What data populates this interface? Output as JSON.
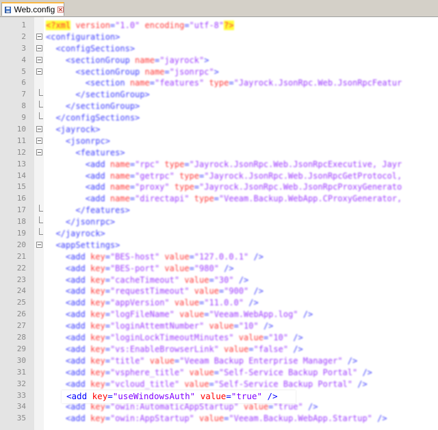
{
  "tab": {
    "label": "Web.config"
  },
  "colors": {
    "tag": "#0000ff",
    "attr": "#ff0000",
    "value": "#8000ff",
    "tab_accent": "#f9b642"
  },
  "lines": [
    {
      "n": "1",
      "fold": "none",
      "segs": [
        [
          "pi",
          "<?xml"
        ],
        [
          "attr",
          " version"
        ],
        [
          "tag",
          "="
        ],
        [
          "val",
          "\"1.0\""
        ],
        [
          "attr",
          " encoding"
        ],
        [
          "tag",
          "="
        ],
        [
          "val",
          "\"utf-8\""
        ],
        [
          "pi",
          "?>"
        ]
      ]
    },
    {
      "n": "2",
      "fold": "open",
      "segs": [
        [
          "tag",
          "<configuration>"
        ]
      ]
    },
    {
      "n": "3",
      "fold": "open",
      "segs": [
        [
          "tag",
          "  <configSections>"
        ]
      ]
    },
    {
      "n": "4",
      "fold": "open",
      "segs": [
        [
          "tag",
          "    <sectionGroup "
        ],
        [
          "attr",
          "name"
        ],
        [
          "tag",
          "="
        ],
        [
          "val",
          "\"jayrock\""
        ],
        [
          "tag",
          ">"
        ]
      ]
    },
    {
      "n": "5",
      "fold": "open",
      "segs": [
        [
          "tag",
          "      <sectionGroup "
        ],
        [
          "attr",
          "name"
        ],
        [
          "tag",
          "="
        ],
        [
          "val",
          "\"jsonrpc\""
        ],
        [
          "tag",
          ">"
        ]
      ]
    },
    {
      "n": "6",
      "fold": "line",
      "segs": [
        [
          "tag",
          "        <section "
        ],
        [
          "attr",
          "name"
        ],
        [
          "tag",
          "="
        ],
        [
          "val",
          "\"features\""
        ],
        [
          "attr",
          " type"
        ],
        [
          "tag",
          "="
        ],
        [
          "val",
          "\"Jayrock.JsonRpc.Web.JsonRpcFeatur"
        ]
      ]
    },
    {
      "n": "7",
      "fold": "end",
      "segs": [
        [
          "tag",
          "      </sectionGroup>"
        ]
      ]
    },
    {
      "n": "8",
      "fold": "end",
      "segs": [
        [
          "tag",
          "    </sectionGroup>"
        ]
      ]
    },
    {
      "n": "9",
      "fold": "end",
      "segs": [
        [
          "tag",
          "  </configSections>"
        ]
      ]
    },
    {
      "n": "10",
      "fold": "open",
      "segs": [
        [
          "tag",
          "  <jayrock>"
        ]
      ]
    },
    {
      "n": "11",
      "fold": "open",
      "segs": [
        [
          "tag",
          "    <jsonrpc>"
        ]
      ]
    },
    {
      "n": "12",
      "fold": "open",
      "segs": [
        [
          "tag",
          "      <features>"
        ]
      ]
    },
    {
      "n": "13",
      "fold": "line",
      "segs": [
        [
          "tag",
          "        <add "
        ],
        [
          "attr",
          "name"
        ],
        [
          "tag",
          "="
        ],
        [
          "val",
          "\"rpc\""
        ],
        [
          "attr",
          " type"
        ],
        [
          "tag",
          "="
        ],
        [
          "val",
          "\"Jayrock.JsonRpc.Web.JsonRpcExecutive, Jayr"
        ]
      ]
    },
    {
      "n": "14",
      "fold": "line",
      "segs": [
        [
          "tag",
          "        <add "
        ],
        [
          "attr",
          "name"
        ],
        [
          "tag",
          "="
        ],
        [
          "val",
          "\"getrpc\""
        ],
        [
          "attr",
          " type"
        ],
        [
          "tag",
          "="
        ],
        [
          "val",
          "\"Jayrock.JsonRpc.Web.JsonRpcGetProtocol,"
        ]
      ]
    },
    {
      "n": "15",
      "fold": "line",
      "segs": [
        [
          "tag",
          "        <add "
        ],
        [
          "attr",
          "name"
        ],
        [
          "tag",
          "="
        ],
        [
          "val",
          "\"proxy\""
        ],
        [
          "attr",
          " type"
        ],
        [
          "tag",
          "="
        ],
        [
          "val",
          "\"Jayrock.JsonRpc.Web.JsonRpcProxyGenerato"
        ]
      ]
    },
    {
      "n": "16",
      "fold": "line",
      "segs": [
        [
          "tag",
          "        <add "
        ],
        [
          "attr",
          "name"
        ],
        [
          "tag",
          "="
        ],
        [
          "val",
          "\"directapi\""
        ],
        [
          "attr",
          " type"
        ],
        [
          "tag",
          "="
        ],
        [
          "val",
          "\"Veeam.Backup.WebApp.CProxyGenerator,"
        ]
      ]
    },
    {
      "n": "17",
      "fold": "end",
      "segs": [
        [
          "tag",
          "      </features>"
        ]
      ]
    },
    {
      "n": "18",
      "fold": "end",
      "segs": [
        [
          "tag",
          "    </jsonrpc>"
        ]
      ]
    },
    {
      "n": "19",
      "fold": "end",
      "segs": [
        [
          "tag",
          "  </jayrock>"
        ]
      ]
    },
    {
      "n": "20",
      "fold": "open",
      "segs": [
        [
          "tag",
          "  <appSettings>"
        ]
      ]
    },
    {
      "n": "21",
      "fold": "line",
      "segs": [
        [
          "tag",
          "    <add "
        ],
        [
          "attr",
          "key"
        ],
        [
          "tag",
          "="
        ],
        [
          "val",
          "\"BES-host\""
        ],
        [
          "attr",
          " value"
        ],
        [
          "tag",
          "="
        ],
        [
          "val",
          "\"127.0.0.1\""
        ],
        [
          "tag",
          " />"
        ]
      ]
    },
    {
      "n": "22",
      "fold": "line",
      "segs": [
        [
          "tag",
          "    <add "
        ],
        [
          "attr",
          "key"
        ],
        [
          "tag",
          "="
        ],
        [
          "val",
          "\"BES-port\""
        ],
        [
          "attr",
          " value"
        ],
        [
          "tag",
          "="
        ],
        [
          "val",
          "\"980\""
        ],
        [
          "tag",
          " />"
        ]
      ]
    },
    {
      "n": "23",
      "fold": "line",
      "segs": [
        [
          "tag",
          "    <add "
        ],
        [
          "attr",
          "key"
        ],
        [
          "tag",
          "="
        ],
        [
          "val",
          "\"cacheTimeout\""
        ],
        [
          "attr",
          " value"
        ],
        [
          "tag",
          "="
        ],
        [
          "val",
          "\"30\""
        ],
        [
          "tag",
          " />"
        ]
      ]
    },
    {
      "n": "24",
      "fold": "line",
      "segs": [
        [
          "tag",
          "    <add "
        ],
        [
          "attr",
          "key"
        ],
        [
          "tag",
          "="
        ],
        [
          "val",
          "\"requestTimeout\""
        ],
        [
          "attr",
          " value"
        ],
        [
          "tag",
          "="
        ],
        [
          "val",
          "\"900\""
        ],
        [
          "tag",
          " />"
        ]
      ]
    },
    {
      "n": "25",
      "fold": "line",
      "segs": [
        [
          "tag",
          "    <add "
        ],
        [
          "attr",
          "key"
        ],
        [
          "tag",
          "="
        ],
        [
          "val",
          "\"appVersion\""
        ],
        [
          "attr",
          " value"
        ],
        [
          "tag",
          "="
        ],
        [
          "val",
          "\"11.0.0\""
        ],
        [
          "tag",
          " />"
        ]
      ]
    },
    {
      "n": "26",
      "fold": "line",
      "segs": [
        [
          "tag",
          "    <add "
        ],
        [
          "attr",
          "key"
        ],
        [
          "tag",
          "="
        ],
        [
          "val",
          "\"logFileName\""
        ],
        [
          "attr",
          " value"
        ],
        [
          "tag",
          "="
        ],
        [
          "val",
          "\"Veeam.WebApp.log\""
        ],
        [
          "tag",
          " />"
        ]
      ]
    },
    {
      "n": "27",
      "fold": "line",
      "segs": [
        [
          "tag",
          "    <add "
        ],
        [
          "attr",
          "key"
        ],
        [
          "tag",
          "="
        ],
        [
          "val",
          "\"loginAttemtNumber\""
        ],
        [
          "attr",
          " value"
        ],
        [
          "tag",
          "="
        ],
        [
          "val",
          "\"10\""
        ],
        [
          "tag",
          " />"
        ]
      ]
    },
    {
      "n": "28",
      "fold": "line",
      "segs": [
        [
          "tag",
          "    <add "
        ],
        [
          "attr",
          "key"
        ],
        [
          "tag",
          "="
        ],
        [
          "val",
          "\"loginLockTimeoutMinutes\""
        ],
        [
          "attr",
          " value"
        ],
        [
          "tag",
          "="
        ],
        [
          "val",
          "\"10\""
        ],
        [
          "tag",
          " />"
        ]
      ]
    },
    {
      "n": "29",
      "fold": "line",
      "segs": [
        [
          "tag",
          "    <add "
        ],
        [
          "attr",
          "key"
        ],
        [
          "tag",
          "="
        ],
        [
          "val",
          "\"vs:EnableBrowserLink\""
        ],
        [
          "attr",
          " value"
        ],
        [
          "tag",
          "="
        ],
        [
          "val",
          "\"false\""
        ],
        [
          "tag",
          " />"
        ]
      ]
    },
    {
      "n": "30",
      "fold": "line",
      "segs": [
        [
          "tag",
          "    <add "
        ],
        [
          "attr",
          "key"
        ],
        [
          "tag",
          "="
        ],
        [
          "val",
          "\"title\""
        ],
        [
          "attr",
          " value"
        ],
        [
          "tag",
          "="
        ],
        [
          "val",
          "\"Veeam Backup Enterprise Manager\""
        ],
        [
          "tag",
          " />"
        ]
      ]
    },
    {
      "n": "31",
      "fold": "line",
      "segs": [
        [
          "tag",
          "    <add "
        ],
        [
          "attr",
          "key"
        ],
        [
          "tag",
          "="
        ],
        [
          "val",
          "\"vsphere_title\""
        ],
        [
          "attr",
          " value"
        ],
        [
          "tag",
          "="
        ],
        [
          "val",
          "\"Self-Service Backup Portal\""
        ],
        [
          "tag",
          " />"
        ]
      ]
    },
    {
      "n": "32",
      "fold": "line",
      "segs": [
        [
          "tag",
          "    <add "
        ],
        [
          "attr",
          "key"
        ],
        [
          "tag",
          "="
        ],
        [
          "val",
          "\"vcloud_title\""
        ],
        [
          "attr",
          " value"
        ],
        [
          "tag",
          "="
        ],
        [
          "val",
          "\"Self-Service Backup Portal\""
        ],
        [
          "tag",
          " />"
        ]
      ]
    },
    {
      "n": "33",
      "fold": "line",
      "highlight": true,
      "segs": [
        [
          "tag",
          "    <add "
        ],
        [
          "attr",
          "key"
        ],
        [
          "tag",
          "="
        ],
        [
          "val",
          "\"useWindowsAuth\""
        ],
        [
          "attr",
          " value"
        ],
        [
          "tag",
          "="
        ],
        [
          "val",
          "\"true\""
        ],
        [
          "tag",
          " />"
        ]
      ]
    },
    {
      "n": "34",
      "fold": "line",
      "segs": [
        [
          "tag",
          "    <add "
        ],
        [
          "attr",
          "key"
        ],
        [
          "tag",
          "="
        ],
        [
          "val",
          "\"owin:AutomaticAppStartup\""
        ],
        [
          "attr",
          " value"
        ],
        [
          "tag",
          "="
        ],
        [
          "val",
          "\"true\""
        ],
        [
          "tag",
          " />"
        ]
      ]
    },
    {
      "n": "35",
      "fold": "line",
      "segs": [
        [
          "tag",
          "    <add "
        ],
        [
          "attr",
          "key"
        ],
        [
          "tag",
          "="
        ],
        [
          "val",
          "\"owin:AppStartup\""
        ],
        [
          "attr",
          " value"
        ],
        [
          "tag",
          "="
        ],
        [
          "val",
          "\"Veeam.Backup.WebApp.Startup\""
        ],
        [
          "tag",
          " />"
        ]
      ]
    }
  ],
  "highlight": {
    "open": "<add ",
    "key_attr": "key",
    "key_eq": "=",
    "key_val": "\"useWindowsAuth\"",
    "value_attr": " value",
    "value_eq": "=",
    "value_val": "\"true\"",
    "close": " />"
  }
}
